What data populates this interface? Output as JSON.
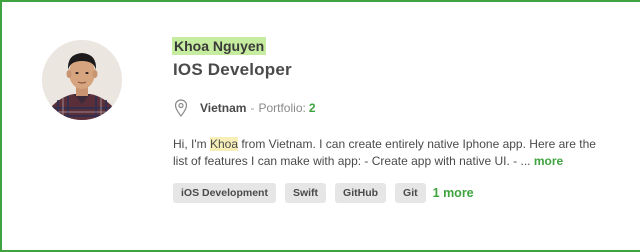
{
  "profile": {
    "name": "Khoa Nguyen",
    "title": "IOS Developer",
    "country": "Vietnam",
    "separator": "-",
    "portfolio_label": "Portfolio:",
    "portfolio_count": "2",
    "description": {
      "line1_before": "Hi, I'm ",
      "line1_highlight": "Khoa",
      "line1_after": " from Vietnam. I can create entirely native Iphone app. Here are the",
      "line2": "list of features I can make with app: - Create app with native UI. - ... ",
      "more_label": "more"
    },
    "tags": [
      "iOS Development",
      "Swift",
      "GitHub",
      "Git"
    ],
    "tags_more_label": "1 more"
  },
  "colors": {
    "accent": "#3fa43f",
    "name_highlight": "#c6ed9f",
    "text_highlight": "#f8efb8",
    "tag_bg": "#e6e6e6"
  },
  "icons": {
    "location": "map-pin-icon"
  }
}
